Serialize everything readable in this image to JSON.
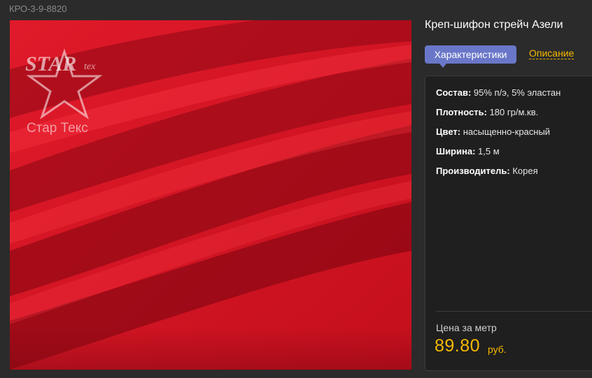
{
  "product": {
    "sku": "КРО-3-9-8820",
    "title": "Креп-шифон стрейч Азели",
    "image_description": "red fabric folds photo",
    "fabric_color": "#d01220"
  },
  "logo": {
    "brand_main": "STAR",
    "brand_small": "tex",
    "subtitle": "Стар Текс"
  },
  "tabs": {
    "active_label": "Характеристики",
    "inactive_label": "Описание",
    "active_color": "#6a77c9",
    "link_color": "#f5b800"
  },
  "specs": [
    {
      "key": "Состав:",
      "value": " 95% п/э, 5% эластан"
    },
    {
      "key": "Плотность:",
      "value": " 180 гр/м.кв."
    },
    {
      "key": "Цвет:",
      "value": " насыщенно-красный"
    },
    {
      "key": "Ширина:",
      "value": " 1,5 м"
    },
    {
      "key": "Производитель:",
      "value": " Корея"
    }
  ],
  "price": {
    "label": "Цена за метр",
    "value": "89.80",
    "currency": "руб.",
    "color": "#f5b800"
  }
}
